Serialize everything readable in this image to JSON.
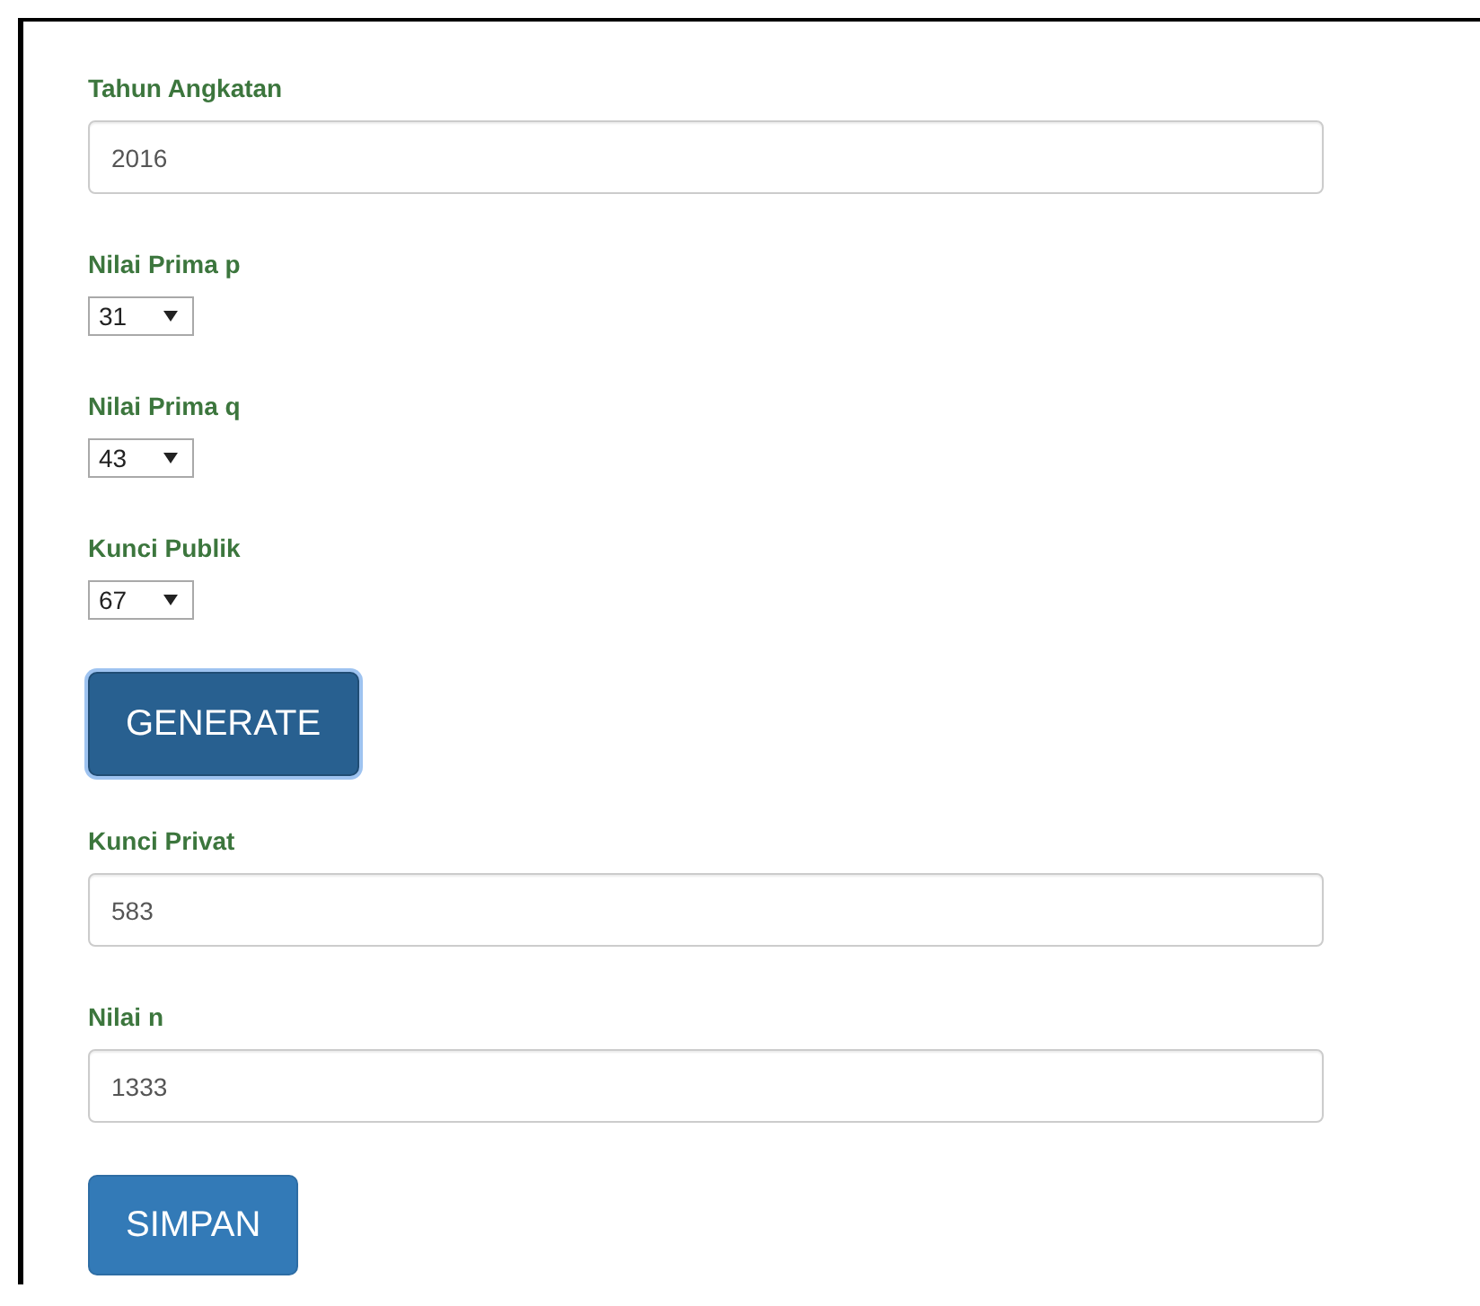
{
  "form": [
    {
      "kind": "text",
      "label": "Tahun Angkatan",
      "value": "2016"
    },
    {
      "kind": "select",
      "label": "Nilai Prima p",
      "value": "31"
    },
    {
      "kind": "select",
      "label": "Nilai Prima q",
      "value": "43"
    },
    {
      "kind": "select",
      "label": "Kunci Publik",
      "value": "67"
    },
    {
      "kind": "button",
      "label": "GENERATE",
      "focused": true
    },
    {
      "kind": "text",
      "label": "Kunci Privat",
      "value": "583"
    },
    {
      "kind": "text",
      "label": "Nilai n",
      "value": "1333"
    },
    {
      "kind": "button",
      "label": "SIMPAN",
      "focused": false
    }
  ]
}
